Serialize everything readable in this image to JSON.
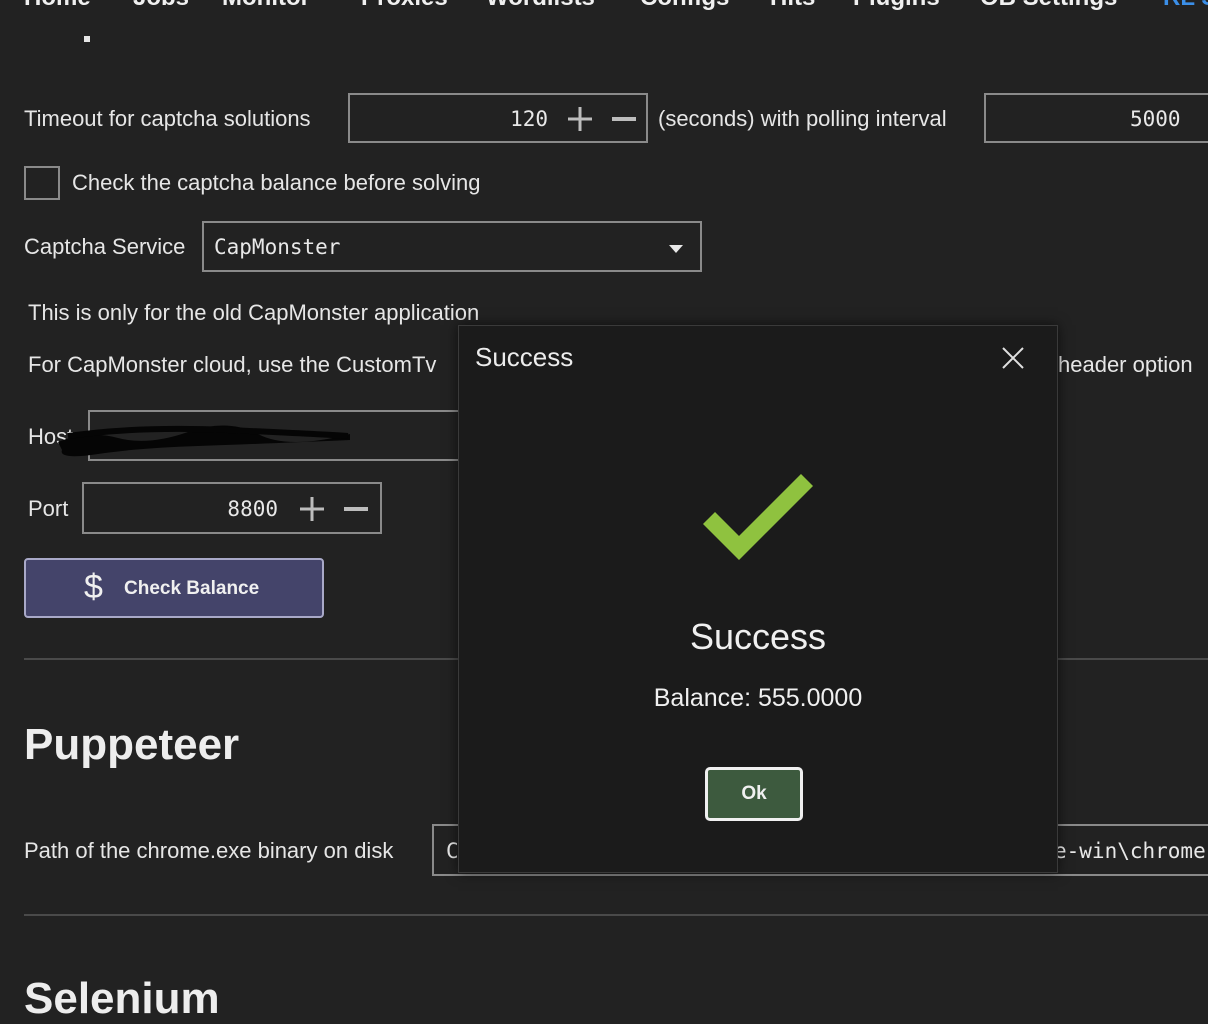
{
  "nav": {
    "items": [
      "Home",
      "Jobs",
      "Monitor",
      "Proxies",
      "Wordlists",
      "Configs",
      "Hits",
      "Plugins",
      "OB Settings",
      "RL S"
    ],
    "active_index": 9
  },
  "captcha": {
    "timeout_label": "Timeout for captcha solutions",
    "timeout_value": "120",
    "polling_label": "(seconds) with polling interval",
    "polling_value": "5000",
    "check_balance_label": "Check the captcha balance before solving",
    "check_balance_checked": false,
    "service_label": "Captcha Service",
    "service_value": "CapMonster",
    "info_line1": "This is only for the old CapMonster application",
    "info_line2_left": "For CapMonster cloud, use the CustomTv",
    "info_line2_right": "header option",
    "host_label": "Host",
    "port_label": "Port",
    "port_value": "8800",
    "check_balance_button": "Check Balance"
  },
  "puppeteer": {
    "heading": "Puppeteer",
    "chrome_path_label": "Path of the chrome.exe binary on disk",
    "chrome_path_start": "C",
    "chrome_path_end": "e-win\\chrome"
  },
  "selenium": {
    "heading": "Selenium"
  },
  "dialog": {
    "title": "Success",
    "heading": "Success",
    "message": "Balance: 555.0000",
    "ok_label": "Ok"
  },
  "colors": {
    "background": "#222222",
    "accent_blue": "#3b8fe8",
    "button_purple": "#44446a",
    "check_green": "#8fc23f",
    "ok_green": "#3d5a3e"
  },
  "icons": [
    "plus-icon",
    "minus-icon",
    "dollar-icon",
    "close-icon",
    "checkmark-icon",
    "chevron-down-icon"
  ]
}
